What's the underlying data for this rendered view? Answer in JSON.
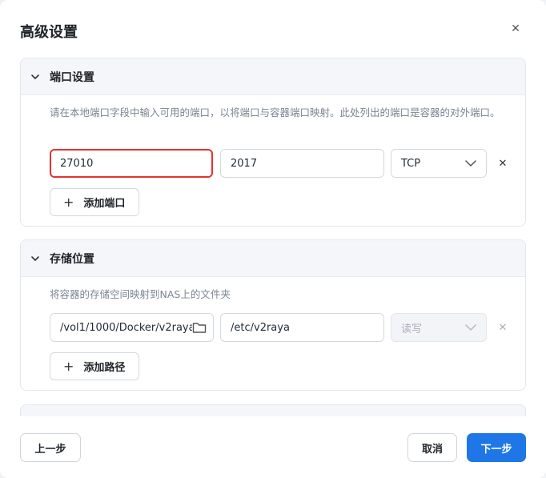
{
  "dialog": {
    "title": "高级设置"
  },
  "ports": {
    "title": "端口设置",
    "description": "请在本地端口字段中输入可用的端口，以将端口与容器端口映射。此处列出的端口是容器的对外端口。",
    "rows": [
      {
        "local_port": "27010",
        "container_port": "2017",
        "protocol": "TCP"
      }
    ],
    "add_label": "添加端口"
  },
  "storage": {
    "title": "存储位置",
    "description": "将容器的存储空间映射到NAS上的文件夹",
    "rows": [
      {
        "nas_path": "/vol1/1000/Docker/v2raya",
        "container_path": "/etc/v2raya",
        "permission": "读写"
      }
    ],
    "add_label": "添加路径"
  },
  "footer": {
    "prev_label": "上一步",
    "cancel_label": "取消",
    "next_label": "下一步"
  },
  "colors": {
    "accent": "#1f76e6",
    "highlight_border": "#e5322d"
  }
}
